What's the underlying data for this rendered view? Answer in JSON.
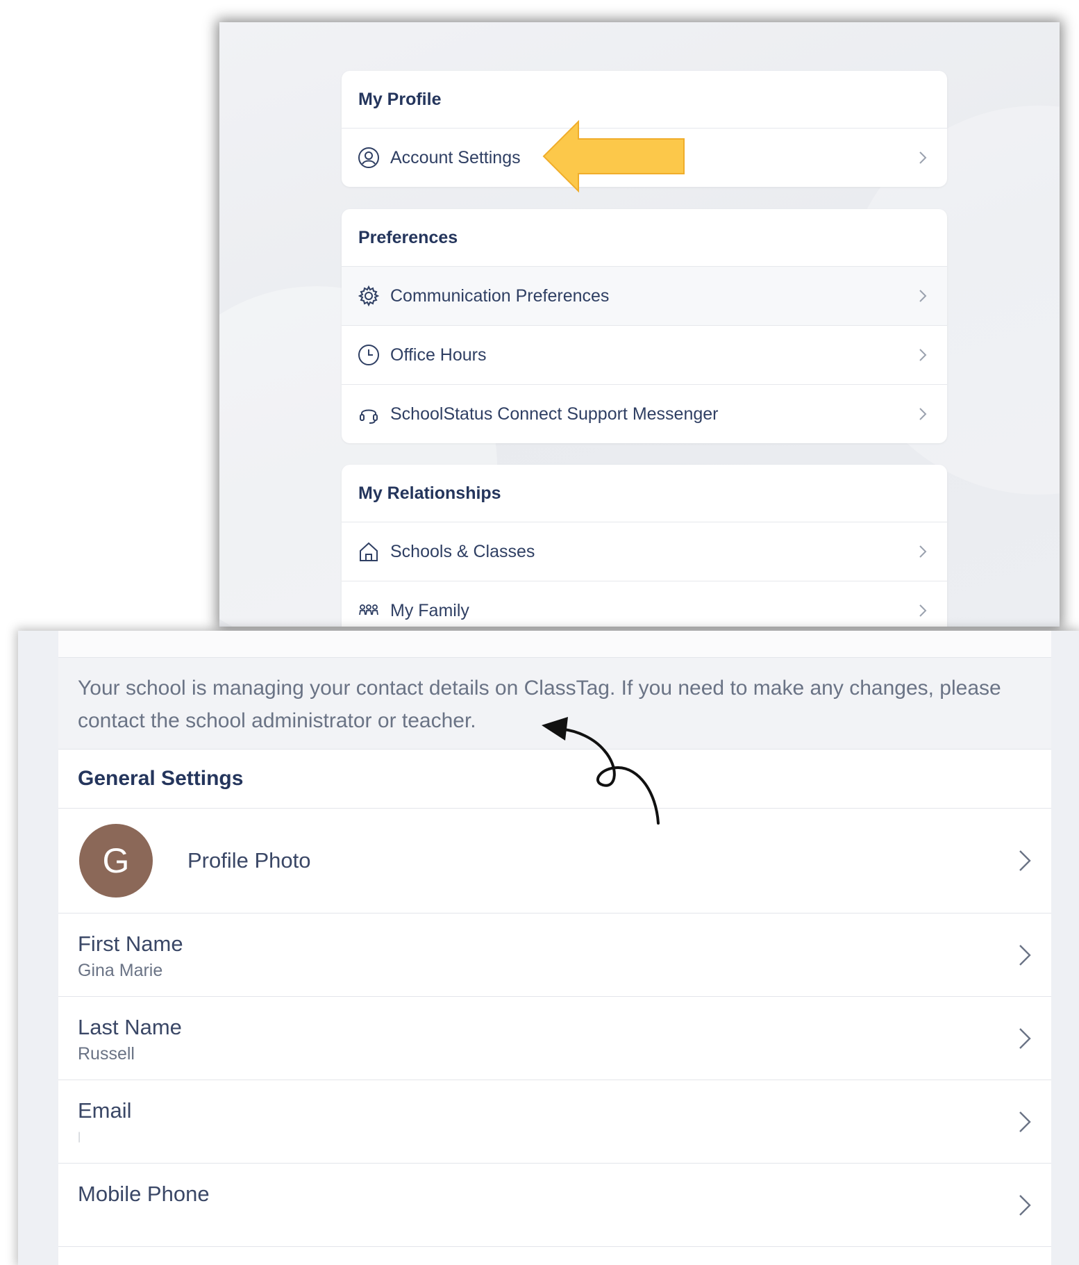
{
  "top_screen": {
    "my_profile": {
      "title": "My Profile",
      "items": [
        {
          "label": "Account Settings",
          "icon": "user-circle-icon"
        }
      ]
    },
    "preferences": {
      "title": "Preferences",
      "items": [
        {
          "label": "Communication Preferences",
          "icon": "gear-icon"
        },
        {
          "label": "Office Hours",
          "icon": "clock-icon"
        },
        {
          "label": "SchoolStatus Connect Support Messenger",
          "icon": "headset-icon"
        }
      ]
    },
    "relationships": {
      "title": "My Relationships",
      "items": [
        {
          "label": "Schools & Classes",
          "icon": "home-icon"
        },
        {
          "label": "My Family",
          "icon": "family-icon"
        }
      ]
    }
  },
  "bottom_screen": {
    "notice": "Your school is managing your contact details on ClassTag. If you need to make any changes, please contact the school administrator or teacher.",
    "general_settings_title": "General Settings",
    "profile_photo": {
      "avatar_letter": "G",
      "label": "Profile Photo",
      "avatar_color": "#8b6858"
    },
    "fields": [
      {
        "label": "First Name",
        "value": "Gina Marie"
      },
      {
        "label": "Last Name",
        "value": "Russell"
      },
      {
        "label": "Email",
        "value": "|"
      },
      {
        "label": "Mobile Phone",
        "value": ""
      }
    ]
  },
  "annotations": {
    "yellow_arrow_color": "#fcc84a",
    "black_arrow_color": "#111111"
  }
}
